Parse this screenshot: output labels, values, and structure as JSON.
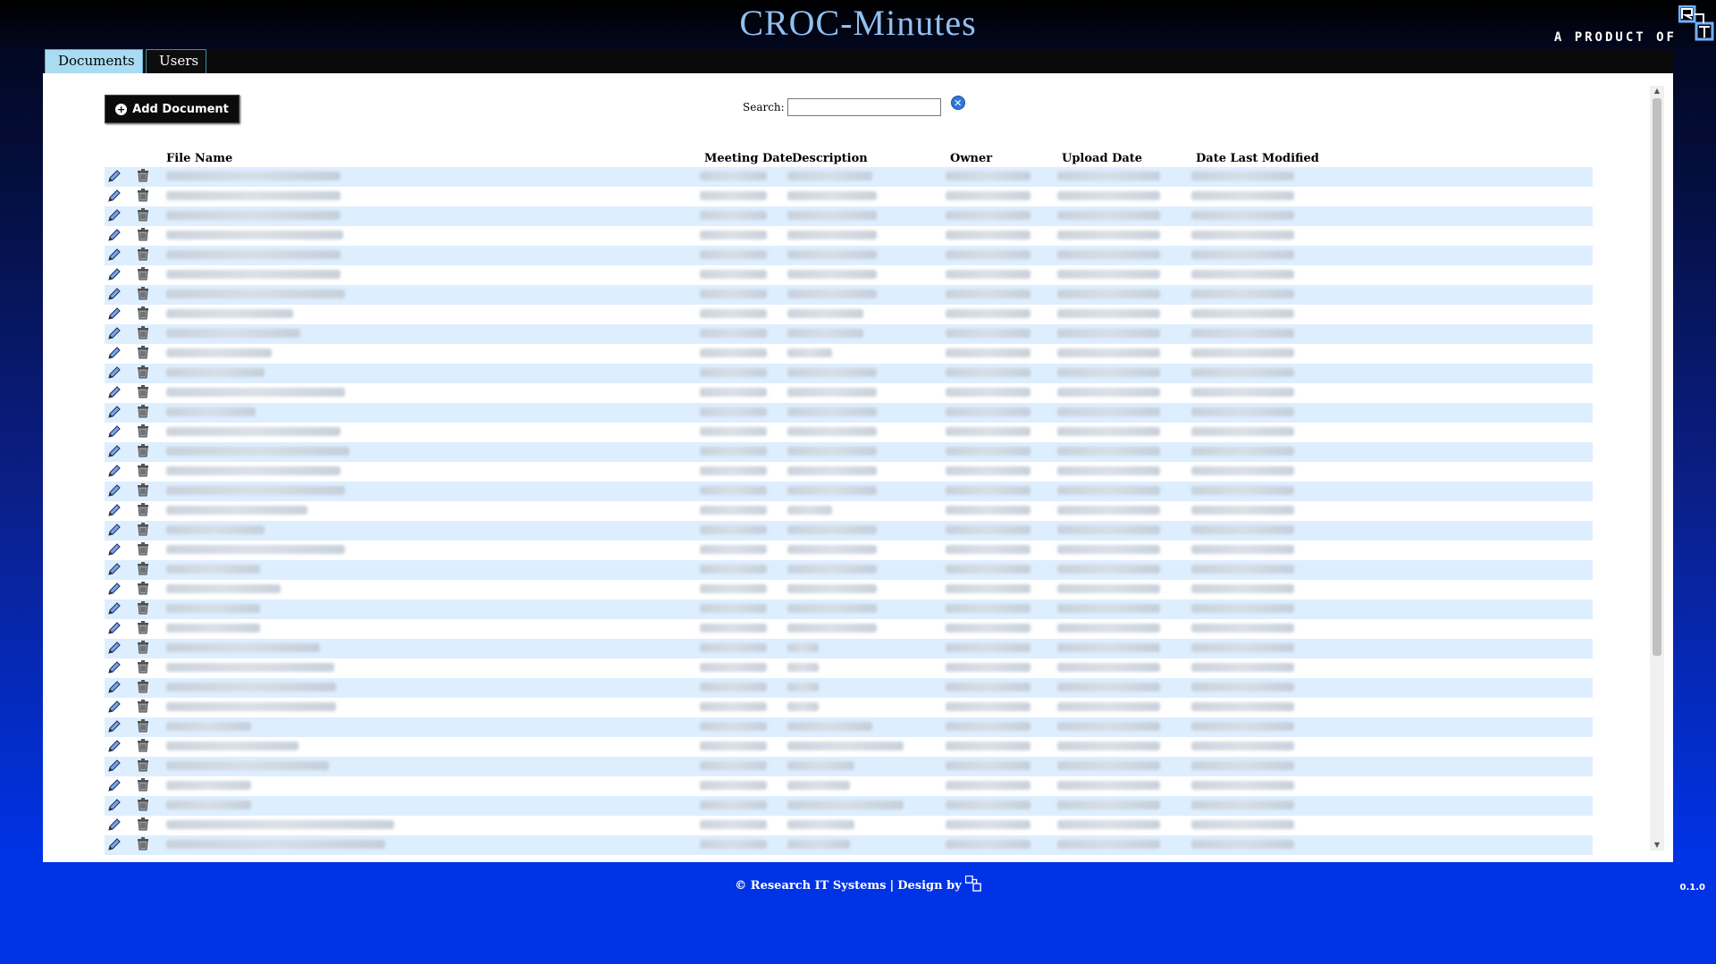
{
  "app": {
    "title": "CROC-Minutes"
  },
  "brand": {
    "text": "A Product of"
  },
  "tabs": [
    {
      "label": "Documents",
      "active": true
    },
    {
      "label": "Users",
      "active": false
    }
  ],
  "toolbar": {
    "add_label": "Add Document"
  },
  "search": {
    "label": "Search:",
    "value": ""
  },
  "table": {
    "columns": [
      "File Name",
      "Meeting Date",
      "Description",
      "Owner",
      "Upload Date",
      "Date Last Modified"
    ],
    "row_count": 35,
    "rows_redacted": true
  },
  "footer": {
    "copyright": "© Research IT Systems",
    "separator": "|",
    "design_by": "Design by"
  },
  "version": "0.1.0",
  "colors": {
    "title": "#93bff0",
    "active_tab": "#a9dcf2",
    "row_alt": "#ddeeff",
    "background_bottom": "#0033e6"
  }
}
